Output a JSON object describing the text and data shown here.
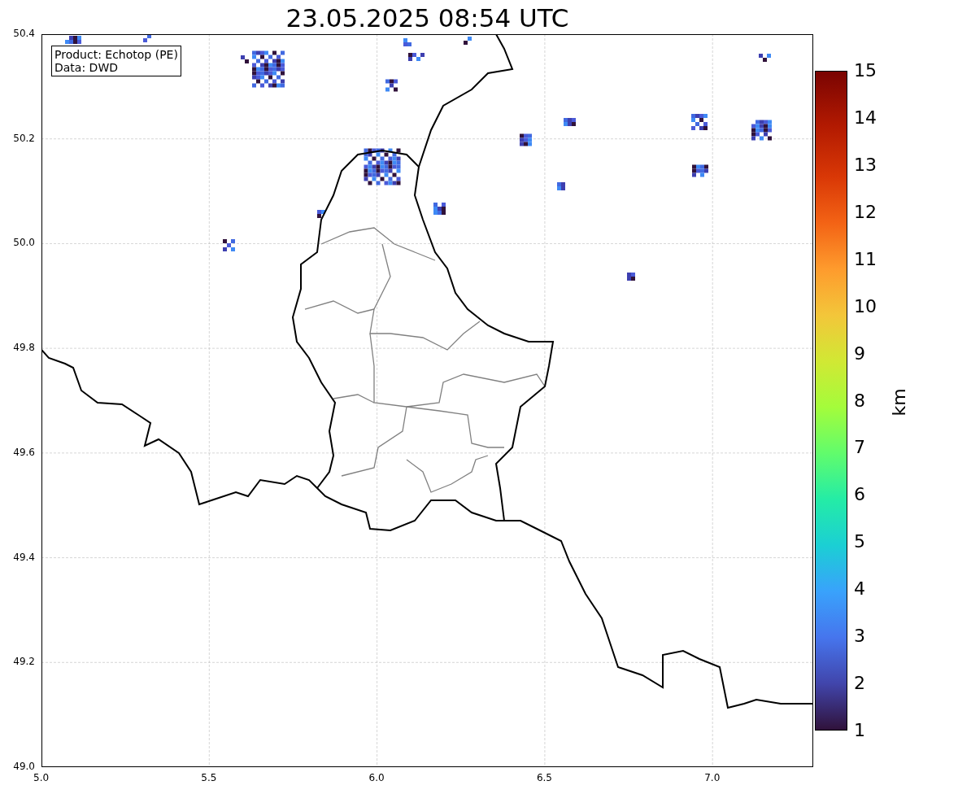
{
  "title": "23.05.2025 08:54 UTC",
  "info_box": [
    "Product: Echotop (PE)",
    "Data: DWD"
  ],
  "x_ticks": [
    "5.0",
    "5.5",
    "6.0",
    "6.5",
    "7.0"
  ],
  "y_ticks": [
    "50.4",
    "50.2",
    "50.0",
    "49.8",
    "49.6",
    "49.4",
    "49.2",
    "49.0"
  ],
  "colorbar": {
    "label": "km",
    "ticks": [
      "15",
      "14",
      "13",
      "12",
      "11",
      "10",
      "9",
      "8",
      "7",
      "6",
      "5",
      "4",
      "3",
      "2",
      "1"
    ]
  }
}
